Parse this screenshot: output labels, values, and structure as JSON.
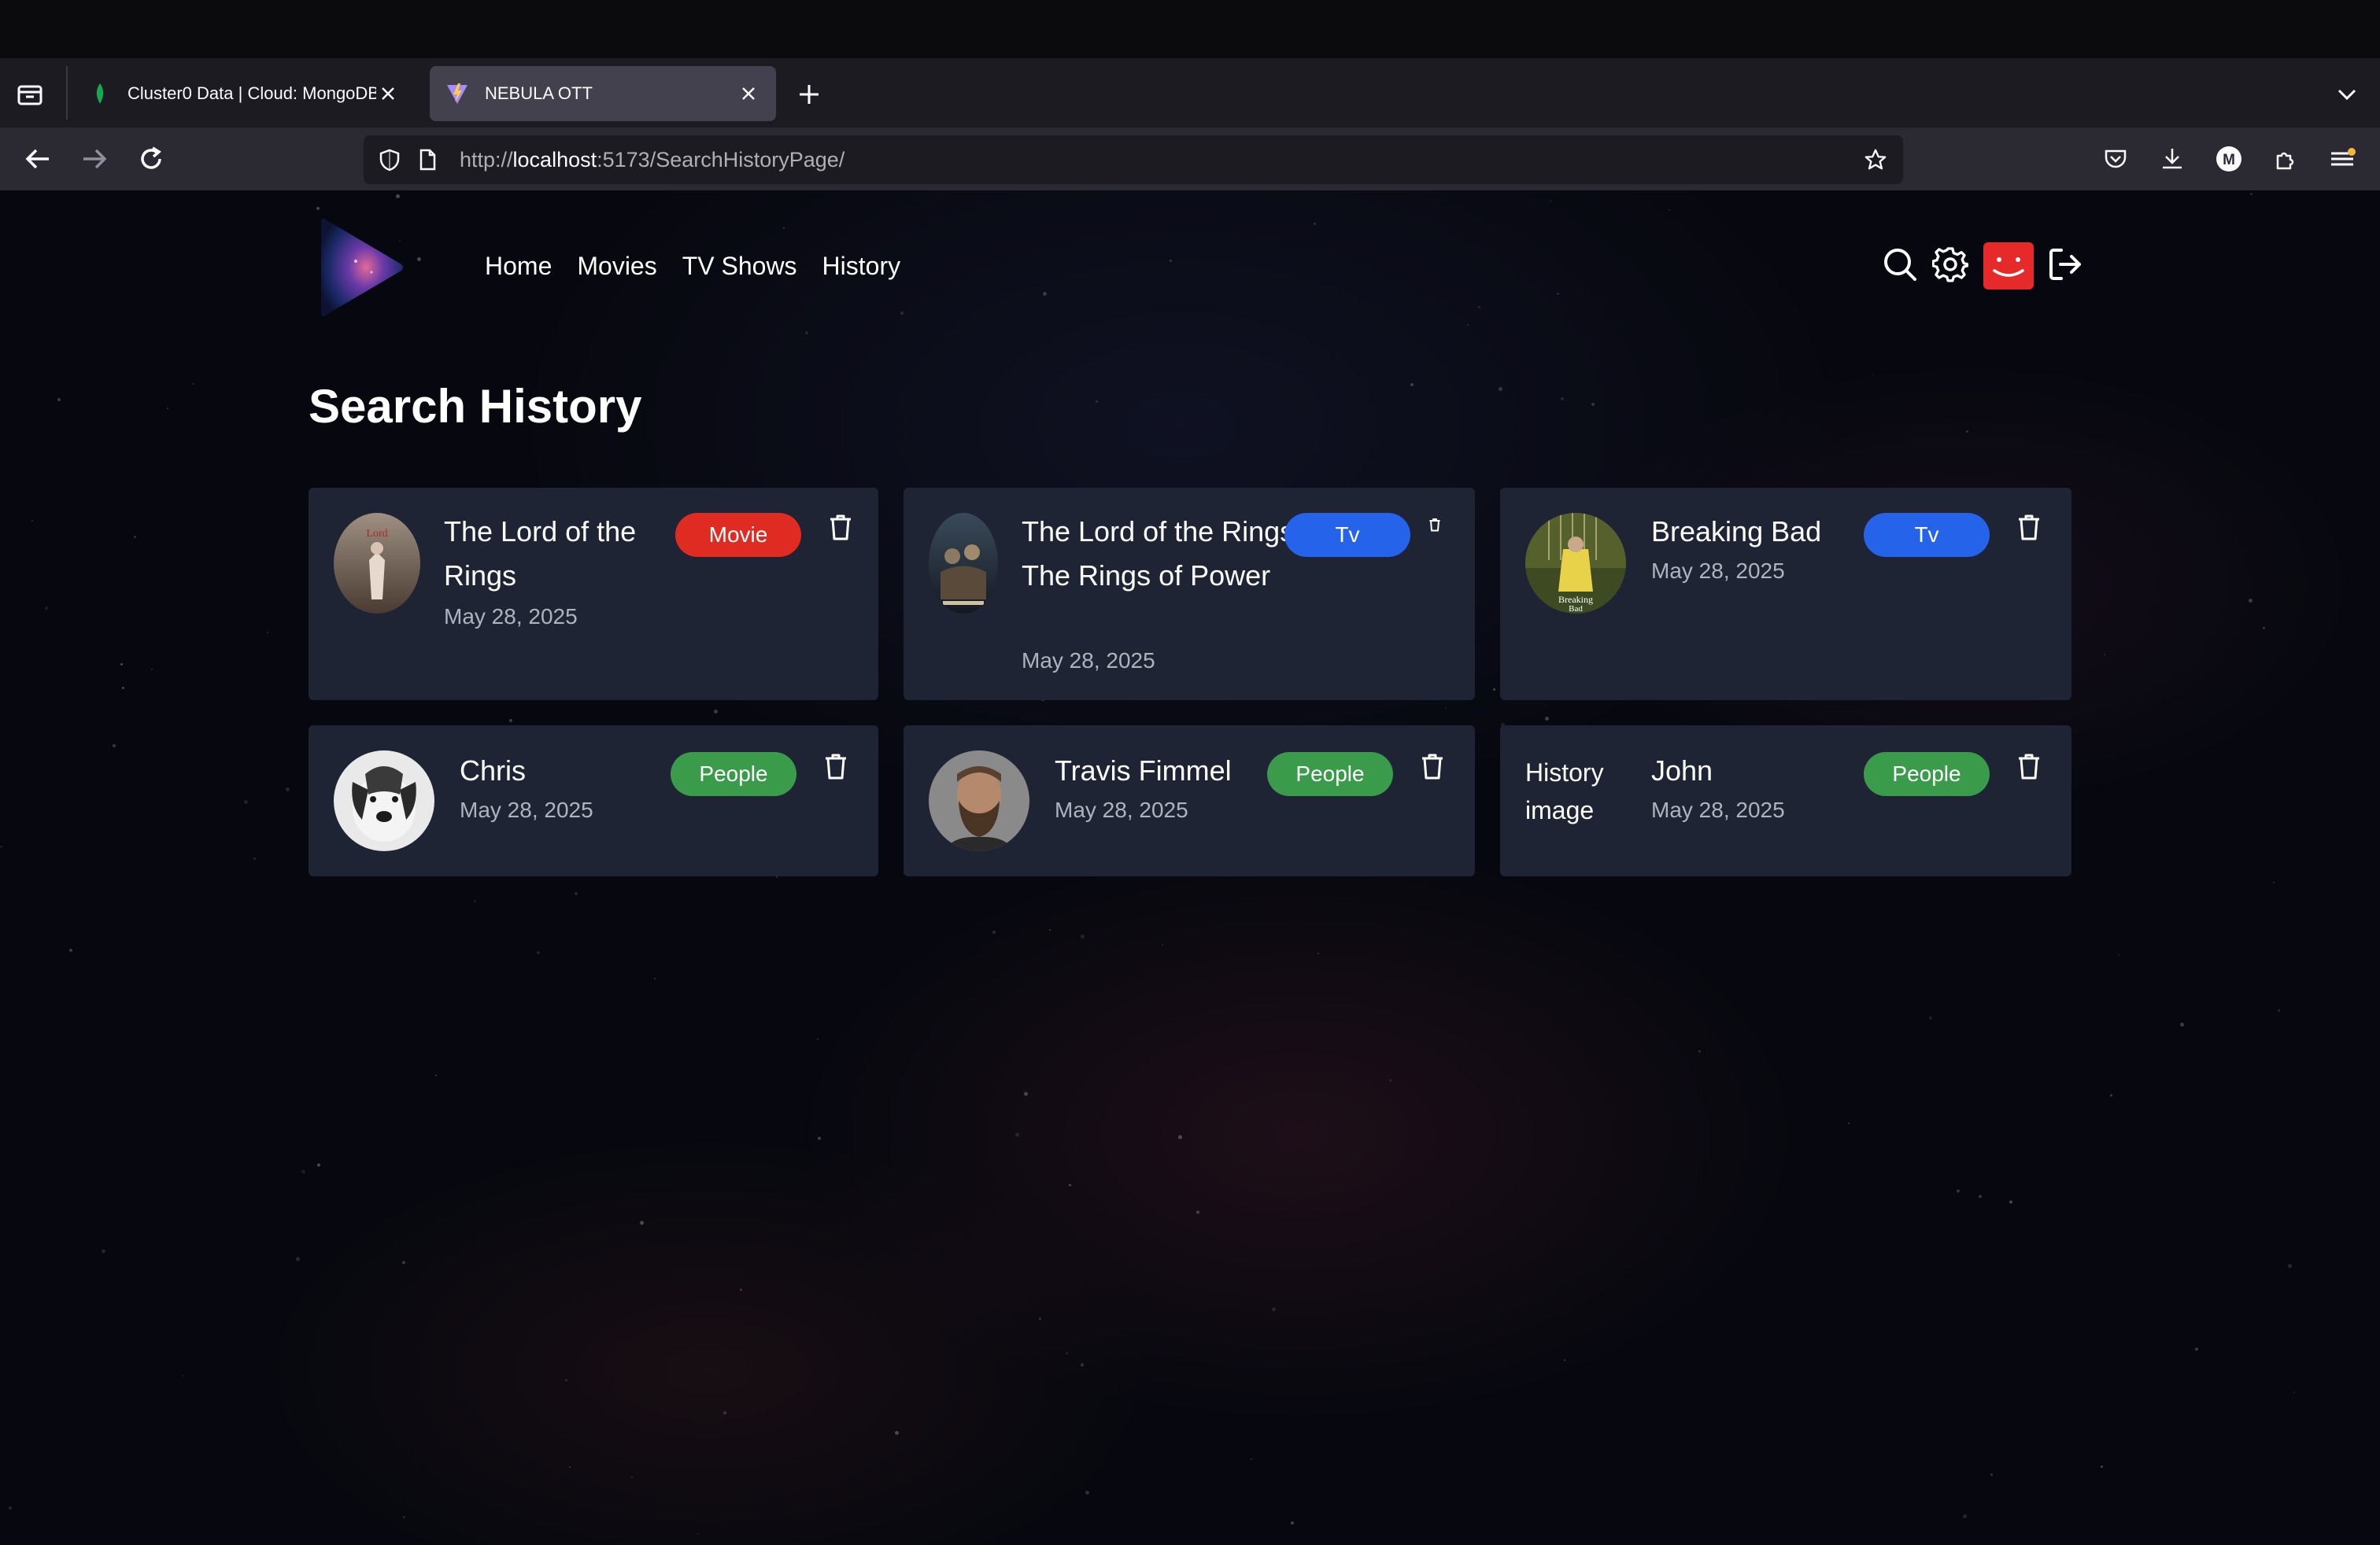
{
  "browser": {
    "tabs": [
      {
        "title": "Cluster0 Data | Cloud: MongoDB",
        "active": false,
        "favicon": "mongodb-leaf-icon"
      },
      {
        "title": "NEBULA OTT",
        "active": true,
        "favicon": "vite-icon"
      }
    ],
    "url": {
      "scheme": "http://",
      "host": "localhost",
      "rest": ":5173/SearchHistoryPage/"
    },
    "profile_initial": "M"
  },
  "site": {
    "nav": [
      "Home",
      "Movies",
      "TV Shows",
      "History"
    ],
    "accent_color": "#e62a2a"
  },
  "page": {
    "title": "Search History"
  },
  "history": [
    {
      "title": "The Lord of the Rings",
      "date": "May 28, 2025",
      "type": "Movie",
      "image": "lotr-poster"
    },
    {
      "title": "The Lord of the Rings: The Rings of Power",
      "date": "May 28, 2025",
      "type": "Tv",
      "image": "rings-of-power-poster"
    },
    {
      "title": "Breaking Bad",
      "date": "May 28, 2025",
      "type": "Tv",
      "image": "breaking-bad-poster"
    },
    {
      "title": "Chris",
      "date": "May 28, 2025",
      "type": "People",
      "image": "dog-photo"
    },
    {
      "title": "Travis Fimmel",
      "date": "May 28, 2025",
      "type": "People",
      "image": "travis-fimmel-photo"
    },
    {
      "title": "John",
      "date": "May 28, 2025",
      "type": "People",
      "image_alt": "History image"
    }
  ],
  "badge_colors": {
    "Movie": "#e02b22",
    "Tv": "#2563eb",
    "People": "#3a9b4a"
  }
}
